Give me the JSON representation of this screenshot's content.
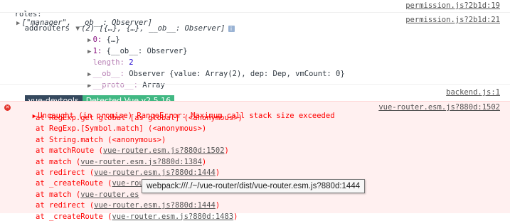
{
  "colors": {
    "accent_vue": "#41b883",
    "devtools_dark": "#35495e",
    "error_red": "#ff0000",
    "error_bg": "#fff0f0"
  },
  "log": {
    "roles_label": "roles:",
    "roles_value": "[\"manager\", __ob__: Observer]",
    "roles_src": "permission.js?2b1d:19",
    "addrouters_label": "addrouters",
    "addrouters_summary": "(2) [{…}, {…}, __ob__: Observer]",
    "addrouters_src": "permission.js?2b1d:21",
    "info_icon": "i",
    "children": [
      {
        "key": "0",
        "value": "{…}"
      },
      {
        "key": "1",
        "value": "{__ob__: Observer}"
      }
    ],
    "length_key": "length",
    "length_value": "2",
    "ob_key": "__ob__",
    "ob_value": "Observer {value: Array(2), dep: Dep, vmCount: 0}",
    "proto_key": "__proto__",
    "proto_value": "Array"
  },
  "devtools": {
    "label": "vue-devtools",
    "detected": "Detected Vue v2.5.16",
    "src": "backend.js:1"
  },
  "error": {
    "message": "Uncaught (in promise) RangeError: Maximum call stack size exceeded",
    "src": "vue-router.esm.js?880d:1502",
    "stack": [
      {
        "prefix": "at RegExp.get global [as global] (<anonymous>)",
        "link": ""
      },
      {
        "prefix": "at RegExp.[Symbol.match] (<anonymous>)",
        "link": ""
      },
      {
        "prefix": "at String.match (<anonymous>)",
        "link": ""
      },
      {
        "prefix": "at matchRoute (",
        "link": "vue-router.esm.js?880d:1502",
        "suffix": ")"
      },
      {
        "prefix": "at match (",
        "link": "vue-router.esm.js?880d:1384",
        "suffix": ")"
      },
      {
        "prefix": "at redirect (",
        "link": "vue-router.esm.js?880d:1444",
        "suffix": ")"
      },
      {
        "prefix": "at _createRoute (",
        "link": "vue-router.esm.js?880d:1483",
        "suffix": ")"
      },
      {
        "prefix": "at match (",
        "link": "vue-router.es",
        "suffix": ""
      },
      {
        "prefix": "at redirect (",
        "link": "vue-router.esm.js?880d:1444",
        "suffix": ")"
      },
      {
        "prefix": "at _createRoute (",
        "link": "vue-router.esm.js?880d:1483",
        "suffix": ")"
      }
    ]
  },
  "tooltip": "webpack:///./~/vue-router/dist/vue-router.esm.js?880d:1444"
}
